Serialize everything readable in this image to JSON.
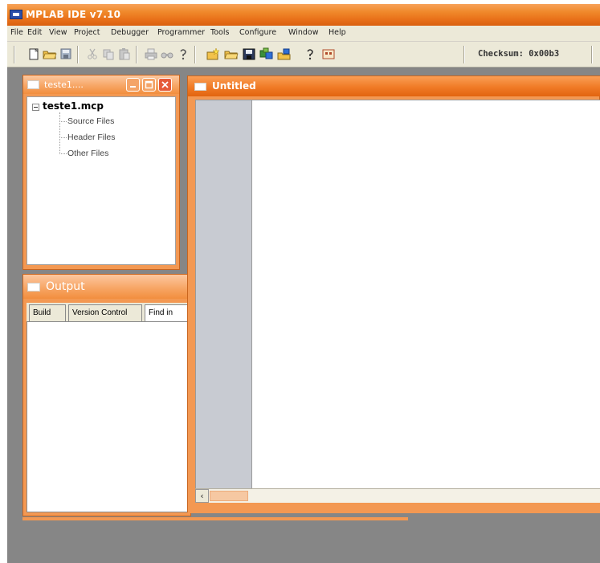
{
  "app": {
    "title": "MPLAB IDE v7.10"
  },
  "menu": {
    "items": [
      "File",
      "Edit",
      "View",
      "Project",
      "Debugger",
      "Programmer",
      "Tools",
      "Configure",
      "Window",
      "Help"
    ]
  },
  "toolbar": {
    "icons": [
      "new-file-icon",
      "open-folder-icon",
      "save-icon",
      "cut-icon",
      "copy-icon",
      "paste-icon",
      "print-icon",
      "find-icon",
      "help-icon",
      "new-project-icon",
      "open-project-icon",
      "save-project-icon",
      "build-icon",
      "make-icon",
      "debug-help-icon",
      "programmer-icon"
    ],
    "checksum": "Checksum: 0x00b3"
  },
  "project_window": {
    "title": "teste1....",
    "root": "teste1.mcp",
    "children": [
      "Source Files",
      "Header Files",
      "Other Files"
    ]
  },
  "output_window": {
    "title": "Output",
    "tabs": [
      "Build",
      "Version Control",
      "Find in"
    ]
  },
  "editor_window": {
    "title": "Untitled"
  },
  "colors": {
    "accent_orange": "#f08a2c",
    "window_frame": "#f39852",
    "desktop_gray": "#868686"
  }
}
